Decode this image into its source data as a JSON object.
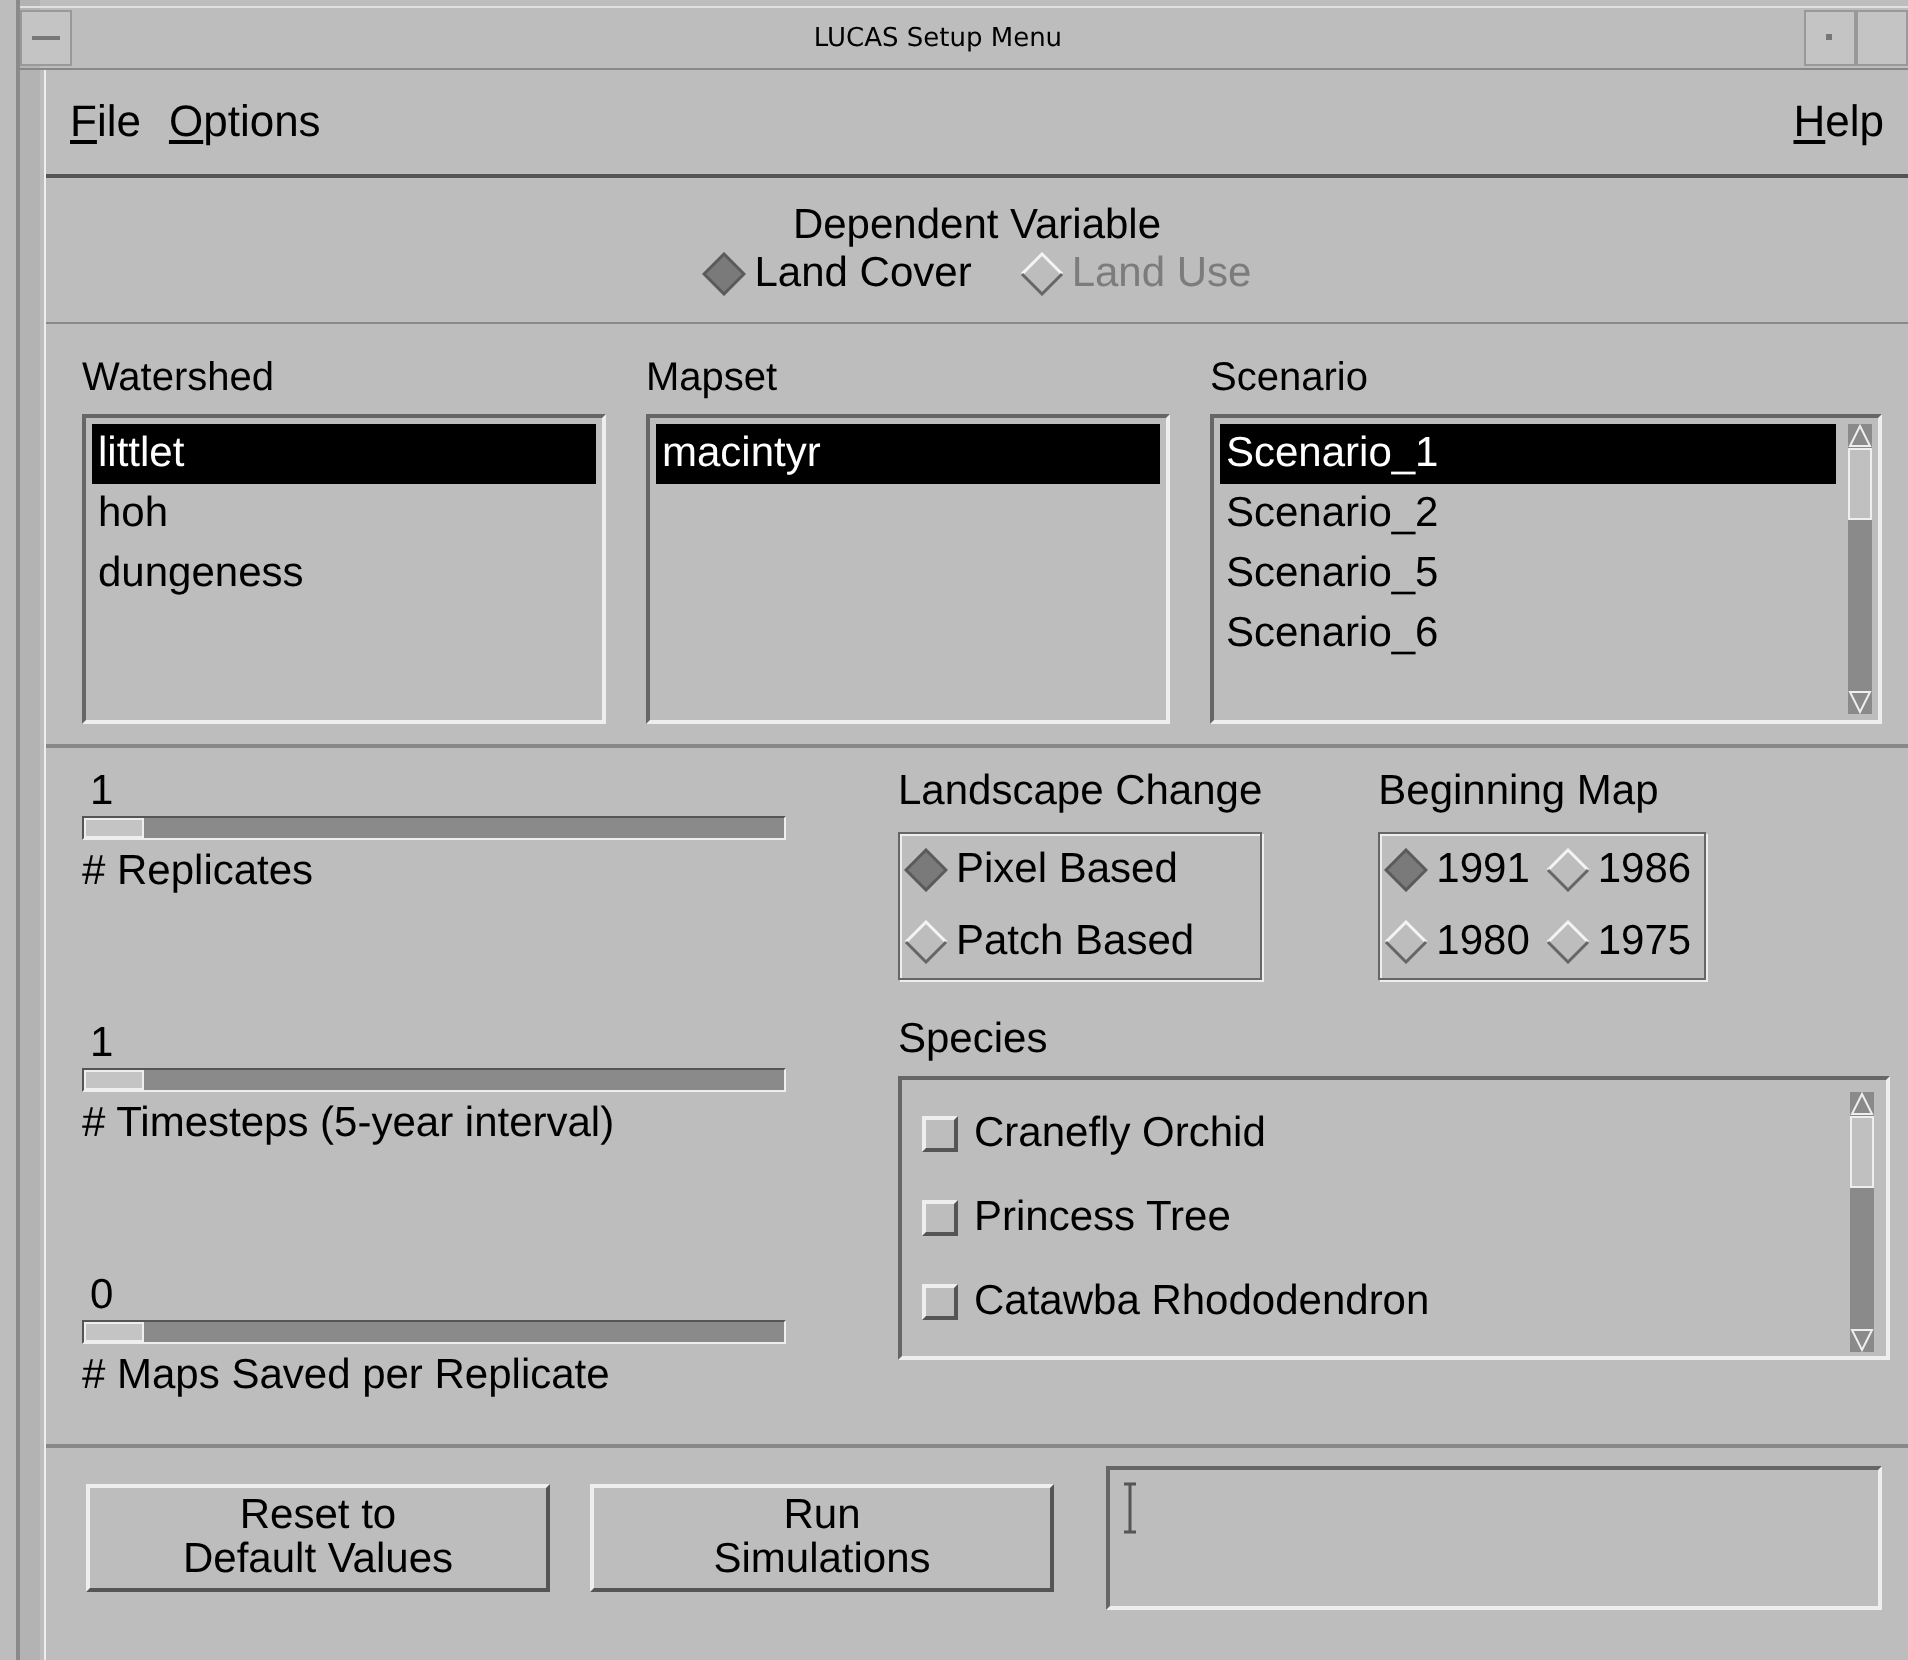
{
  "window": {
    "title": "LUCAS Setup Menu"
  },
  "menu": [
    {
      "label": "File"
    },
    {
      "label": "Options"
    },
    {
      "label": "Help"
    }
  ],
  "dependent_variable": {
    "title": "Dependent Variable",
    "options": [
      {
        "label": "Land Cover",
        "selected": true,
        "disabled": false
      },
      {
        "label": "Land Use",
        "selected": false,
        "disabled": true
      }
    ]
  },
  "lists": [
    {
      "title": "Watershed",
      "scrollable": false,
      "items": [
        {
          "label": "littlet",
          "selected": true
        },
        {
          "label": "hoh",
          "selected": false
        },
        {
          "label": "dungeness",
          "selected": false
        }
      ]
    },
    {
      "title": "Mapset",
      "scrollable": false,
      "items": [
        {
          "label": "macintyr",
          "selected": true
        }
      ]
    },
    {
      "title": "Scenario",
      "scrollable": true,
      "items": [
        {
          "label": "Scenario_1",
          "selected": true
        },
        {
          "label": "Scenario_2",
          "selected": false
        },
        {
          "label": "Scenario_5",
          "selected": false
        },
        {
          "label": "Scenario_6",
          "selected": false
        }
      ]
    }
  ],
  "sliders": [
    {
      "value": "1",
      "label": "# Replicates",
      "level": 0
    },
    {
      "value": "1",
      "label": "# Timesteps (5-year interval)",
      "level": 0
    },
    {
      "value": "0",
      "label": "# Maps Saved per Replicate",
      "level": 0
    }
  ],
  "landscape_change": {
    "title": "Landscape Change",
    "options": [
      {
        "label": "Pixel Based",
        "selected": true
      },
      {
        "label": "Patch Based",
        "selected": false
      }
    ]
  },
  "beginning_map": {
    "title": "Beginning Map",
    "options": [
      {
        "label": "1991",
        "selected": true
      },
      {
        "label": "1986",
        "selected": false
      },
      {
        "label": "1980",
        "selected": false
      },
      {
        "label": "1975",
        "selected": false
      }
    ]
  },
  "species": {
    "title": "Species",
    "items": [
      {
        "label": "Cranefly Orchid",
        "checked": false
      },
      {
        "label": "Princess Tree",
        "checked": false
      },
      {
        "label": "Catawba Rhododendron",
        "checked": false
      }
    ]
  },
  "buttons": [
    {
      "lines": [
        "Reset to",
        "Default Values"
      ]
    },
    {
      "lines": [
        "Run",
        "Simulations"
      ]
    }
  ]
}
